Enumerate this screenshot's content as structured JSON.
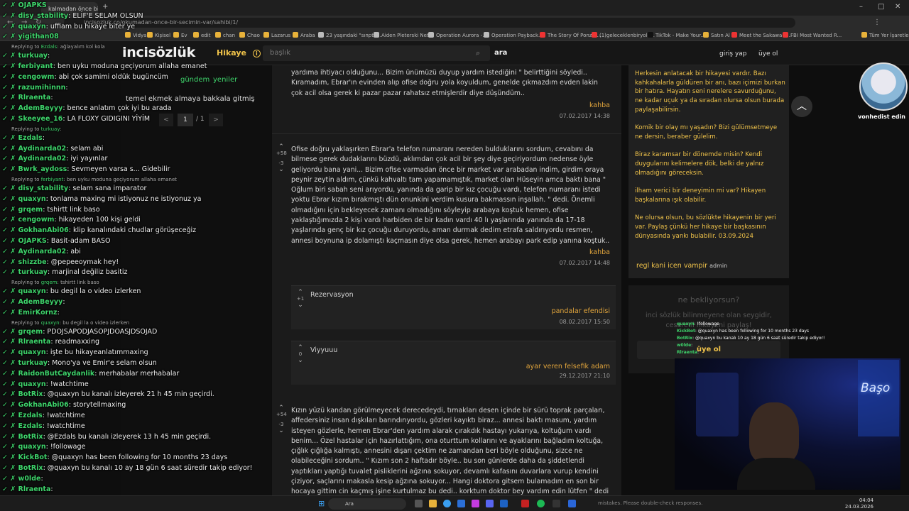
{
  "browser": {
    "tab_title": "kalmadan önce bir seçimin var",
    "url": "incisozluk.co/okumadan-once-bir-secimin-var/sahibi/1/",
    "bookmarks": [
      "Vidya",
      "Kişisel",
      "Ev",
      "edit",
      "chan",
      "Chao",
      "Lazarus",
      "Araba",
      "23 yaşındaki \"sınpto...",
      "Aiden Pleterski Net...",
      "Operation Aurora -...",
      "Operation Payback...",
      "The Story Of Ponzi -...",
      "(1)geleceklenbiryolc...",
      "TikTok - Make Your...",
      "Satın Al",
      "Meet the Sakawa B...",
      "FBI Most Wanted R...",
      "Tüm Yer İşaretleri"
    ]
  },
  "site": {
    "logo": "incisözlük",
    "section": "Hikaye",
    "search_placeholder": "başlık",
    "search_button": "ara",
    "login": "giriş yap",
    "signup": "üye ol"
  },
  "leftpanel": {
    "gundem": "gündem",
    "yeniler": "yeniler",
    "topic": "temel ekmek almaya bakkala gitmiş",
    "page_current": "1",
    "page_total": "/ 1",
    "prev": "<",
    "next": ">"
  },
  "entries": [
    {
      "text": "yardıma ihtiyacı olduğunu... Bizim ünümüzü duyup yardım istediğini \" belirttiğini söyledi.. Kıramadım, Ebrar'ın evinden alıp ofise doğru yola koyuldum, genelde çıkmazdım evden lakin çok acil olsa gerek ki pazar pazar rahatsız etmişlerdir diye düşündüm..",
      "author": "kahba",
      "date": "07.02.2017 14:38"
    },
    {
      "vote_up": "+58",
      "vote_down": "-3",
      "text": "Ofise doğru yaklaşırken Ebrar'a telefon numaranı nereden bulduklarını sordum, cevabını da bilmese gerek dudaklarını büzdü, aklımdan çok acil bir şey diye geçiriyordum nedense öyle geliyordu bana yani... Bizim ofise varmadan önce bir market var arabadan indim, girdim oraya peynir zeytin aldım, çünkü kahvaltı tam yapamamıştık, market olan Hüseyin amca baktı bana \" Oğlum biri sabah seni arıyordu, yanında da garip bir kız çocuğu vardı, telefon numaranı istedi yoktu Ebrar kızım bırakmıştı dün onunkini verdim kusura bakmassın inşallah. \" dedi. Önemli olmadığını için bekleyecek zamanı olmadığını söyleyip arabaya koştuk hemen, ofise yaklaştığımızda 2 kişi vardı harbiden de bir kadın vardı 40 lı yaşlarında yanında da 17-18 yaşlarında genç bir kız çocuğu duruyordu, aman durmak dedim etrafa saldırıyordu resmen, annesi boynuna ip dolamıştı kaçmasın diye olsa gerek, hemen arabayı park edip yanına koştuk..",
      "author": "kahba",
      "date": "07.02.2017 14:48"
    }
  ],
  "subentries": [
    {
      "vote": "+1",
      "text": "Rezervasyon",
      "author": "pandalar efendisi",
      "date": "08.02.2017 15:50"
    },
    {
      "vote": "0",
      "text": "Viyyuuu",
      "author": "ayar veren felsefik adam",
      "date": "29.12.2017 21:10"
    }
  ],
  "entry3": {
    "vote_up": "+54",
    "vote_down": "-3",
    "text": "Kızın yüzü kandan görülmeyecek derecedeydi, tırnakları desen içinde bir sürü toprak parçaları, affedersiniz insan dışkıları barındırıyordu, gözleri kayıktı biraz... annesi baktı masum, yardım isteyen gözlerle, hemen Ebrar'den yardım alarak çırakdık hastayı yukarıya, koltuğum vardı benim... Özel hastalar için hazırlattığım, ona oturttum kollarını ve ayaklarını bağladım koltuğa, çığlık çığlığa kalmıştı, annesini dışarı çektim ne zamandan beri böyle olduğunu, sizce ne olabileceğini sordum.. \" Kızım son 2 haftadır böyle.. bu son günlerde daha da şiddetlendi yaptıkları yaptığı tuvalet pisliklerini ağzına sokuyor, devamlı kafasını duvarlara vurup kendini çiziyor, saçlarını makasla kesip ağzına sokuyor... Hangi doktora gitsem bulamadım en son bir hocaya gittim cin kaçmış işine kurtulmaz bu dedi.. korktum doktor bey vardım edin lütfen \" dedi bana \" iyi yapmışsınız, cin min"
  },
  "rightpanel": {
    "paragraphs": [
      "Herkesin anlatacak bir hikayesi vardır. Bazı kahkahalarla güldüren bir anı, bazı içimizi burkan bir hatıra. Hayatın seni nerelere savurduğunu, ne kadar uçuk ya da sıradan olursa olsun burada paylaşabilirsin.",
      "Komik bir olay mı yaşadın? Bizi gülümsetmeye ne dersin, beraber gülelim.",
      "Biraz karamsar bir dönemde misin? Kendi duygularını kelimelere dök, belki de yalnız olmadığını göreceksin.",
      "ilham verici bir deneyimin mi var? Hikayen başkalarına ışık olabilir.",
      "Ne olursa olsun, bu sözlükte hikayenin bir yeri var. Paylaş çünkü her hikaye bir başkasının dünyasında yankı bulabilir. 03.09.2024"
    ],
    "owner": "regl kani icen vampir",
    "owner_role": "admin",
    "promo_title": "ne bekliyorsun?",
    "promo_text": "inci sözlük bilinmeyene olan seygidir, cesaretli hikayeni paylaş!",
    "promo_button": "üye ol"
  },
  "chat": [
    {
      "t": "line",
      "u": "OJAPKS",
      "m": ""
    },
    {
      "t": "line",
      "u": "disy_stability",
      "m": ": ELİF'E SELAM OLSUN"
    },
    {
      "t": "line",
      "u": "quaxyn",
      "m": ": uffiam bu hikaye biter ye"
    },
    {
      "t": "line",
      "u": "yigithan08",
      "m": ""
    },
    {
      "t": "reply",
      "to": "Ezdals",
      "m": "ağlayalım kol kola"
    },
    {
      "t": "line",
      "u": "turkuay",
      "m": ":"
    },
    {
      "t": "line",
      "u": "ferbiyant",
      "m": ": ben uyku moduna geçiyorum allaha emanet"
    },
    {
      "t": "line",
      "u": "cengowm",
      "m": ": abi çok samimi oldük bugüncüm"
    },
    {
      "t": "line",
      "u": "razumihinnn",
      "m": ":"
    },
    {
      "t": "line",
      "u": "Rlraenta",
      "m": ":"
    },
    {
      "t": "line",
      "u": "AdemBeyyy",
      "m": ": bence anlatım çok iyi bu arada"
    },
    {
      "t": "line",
      "u": "Skeeyee_16",
      "m": ": LA FLOXY GIDIGINI YİYİM"
    },
    {
      "t": "reply",
      "to": "turkuay",
      "m": ""
    },
    {
      "t": "line",
      "u": "Ezdals",
      "m": ":"
    },
    {
      "t": "line",
      "u": "Aydinarda02",
      "m": ": selam abi"
    },
    {
      "t": "line",
      "u": "Aydinarda02",
      "m": ": iyi yayınlar"
    },
    {
      "t": "line",
      "u": "Bwrk_aydoss",
      "m": ": Sevmeyen varsa s... Gidebilir"
    },
    {
      "t": "reply",
      "to": "ferbiyant",
      "m": "ben uyku moduna geçiyorum allaha emanet"
    },
    {
      "t": "line",
      "u": "disy_stability",
      "m": ": selam sana imparator"
    },
    {
      "t": "line",
      "u": "quaxyn",
      "m": ": tonlama maxing mi istiyonuz ne istiyonuz ya"
    },
    {
      "t": "line",
      "u": "grqem",
      "m": ": tshirtt link baso"
    },
    {
      "t": "line",
      "u": "cengowm",
      "m": ": hikayeden 100 kişi geldi"
    },
    {
      "t": "line",
      "u": "GokhanAbi06",
      "m": ": klip kanalındaki chudlar görüşeceğiz"
    },
    {
      "t": "line",
      "u": "OJAPKS",
      "m": ": Basit-adam BASO"
    },
    {
      "t": "line",
      "u": "Aydinarda02",
      "m": ": abi"
    },
    {
      "t": "line",
      "u": "shizzbe",
      "m": ": @pepeeoymak hey!"
    },
    {
      "t": "line",
      "u": "turkuay",
      "m": ": marjinal değiliz basitiz"
    },
    {
      "t": "reply",
      "to": "grqem",
      "m": "tshirtt link baso"
    },
    {
      "t": "line",
      "u": "quaxyn",
      "m": ": bu degil la o video izlerken"
    },
    {
      "t": "line",
      "u": "AdemBeyyy",
      "m": ":"
    },
    {
      "t": "line",
      "u": "EmirKornz",
      "m": ":"
    },
    {
      "t": "reply",
      "to": "quaxyn",
      "m": "bu degil la o video izlerken"
    },
    {
      "t": "line",
      "u": "grqem",
      "m": ": PDOJSAPODJASOPJDOASJDSOJAD"
    },
    {
      "t": "line",
      "u": "Rlraenta",
      "m": ": readmaxxing"
    },
    {
      "t": "line",
      "u": "quaxyn",
      "m": ": işte bu hikayeanlatımmaxing"
    },
    {
      "t": "line",
      "u": "turkuay",
      "m": ": Mono'ya ve Emir'e selam olsun"
    },
    {
      "t": "line",
      "u": "RaidonButCaydanlik",
      "m": ": merhabalar merhabalar"
    },
    {
      "t": "line",
      "u": "quaxyn",
      "m": ": !watchtime"
    },
    {
      "t": "line",
      "u": "BotRix",
      "m": ": @quaxyn bu kanalı izleyerek 21 h 45 min geçirdi."
    },
    {
      "t": "line",
      "u": "GokhanAbi06",
      "m": ": storytellmaxing"
    },
    {
      "t": "line",
      "u": "Ezdals",
      "m": ": !watchtime"
    },
    {
      "t": "line",
      "u": "Ezdals",
      "m": ": !watchtime"
    },
    {
      "t": "line",
      "u": "BotRix",
      "m": ": @Ezdals bu kanalı izleyerek 13 h 45 min geçirdi."
    },
    {
      "t": "line",
      "u": "quaxyn",
      "m": ": !followage"
    },
    {
      "t": "line",
      "u": "KickBot",
      "m": ": @quaxyn has been following for 10 months 23 days"
    },
    {
      "t": "line",
      "u": "BotRix",
      "m": ": @quaxyn bu kanalı 10 ay 18 gün 6 saat süredir takip ediyor!"
    },
    {
      "t": "line",
      "u": "w0lde",
      "m": ":"
    },
    {
      "t": "line",
      "u": "Rlraenta",
      "m": ":"
    }
  ],
  "minichat": [
    {
      "u": "quaxyn",
      "m": ": !followage"
    },
    {
      "u": "KickBot",
      "m": ": @quaxyn has been following for 10 months 23 days"
    },
    {
      "u": "BotRix",
      "m": ": @quaxyn bu kanalı 10 ay 18 gün 6 saat süredir takip ediyor!"
    },
    {
      "u": "w0lde",
      "m": ":"
    },
    {
      "u": "Rlraenta",
      "m": ":"
    }
  ],
  "overlay": {
    "avatar_label": "vonhedist edin",
    "neon_sign": "Başo"
  },
  "taskbar": {
    "search": "Ara",
    "time": "04:04",
    "date": "24.03.2026",
    "notice": "mistakes. Please double-check responses."
  }
}
